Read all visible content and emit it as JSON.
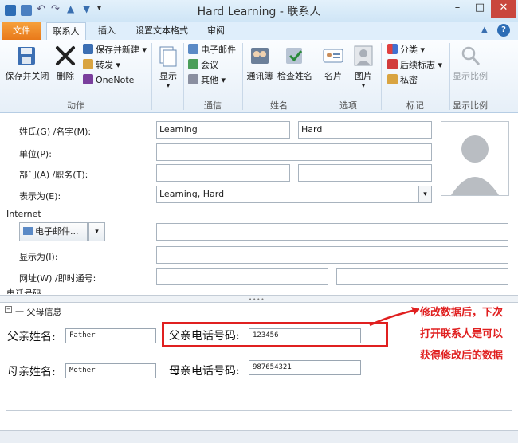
{
  "window": {
    "title": "Hard Learning - 联系人",
    "buttons": {
      "help": "?"
    }
  },
  "tabs": [
    {
      "label": "文件"
    },
    {
      "label": "联系人"
    },
    {
      "label": "插入"
    },
    {
      "label": "设置文本格式"
    },
    {
      "label": "审阅"
    }
  ],
  "ribbon": {
    "actions": {
      "label": "动作",
      "save_close": "保存并关闭",
      "delete": "删除",
      "save_new": "保存并新建",
      "forward": "转发",
      "onenote": "OneNote"
    },
    "show": {
      "label": "显示"
    },
    "communicate": {
      "label": "通信",
      "email": "电子邮件",
      "meeting": "会议",
      "other": "其他"
    },
    "names": {
      "label": "姓名",
      "address_book": "通讯簿",
      "check_names": "检查姓名"
    },
    "options": {
      "label": "选项",
      "card": "名片",
      "picture": "图片"
    },
    "tags": {
      "label": "标记",
      "categorize": "分类",
      "followup": "后续标志",
      "private": "私密"
    },
    "zoom": {
      "label": "显示比例",
      "button": "显示比例"
    }
  },
  "form": {
    "name_label": "姓氏(G)  /名字(M):",
    "last_name": "Learning",
    "first_name": "Hard",
    "company_label": "单位(P):",
    "company": "",
    "dept_label": "部门(A)  /职务(T):",
    "department": "",
    "job_title": "",
    "display_as_label": "表示为(E):",
    "display_as": "Learning, Hard",
    "internet_header": "Internet",
    "email_button": "电子邮件...",
    "email": "",
    "email_display_label": "显示为(I):",
    "email_display": "",
    "web_label": "网址(W)  /即时通号:",
    "web": "",
    "im": "",
    "phone_header": "电话号码"
  },
  "parents": {
    "header": "父母信息",
    "father_name_label": "父亲姓名:",
    "father_name": "Father",
    "father_phone_label": "父亲电话号码:",
    "father_phone": "123456",
    "mother_name_label": "母亲姓名:",
    "mother_name": "Mother",
    "mother_phone_label": "母亲电话号码:",
    "mother_phone": "987654321"
  },
  "annotation": {
    "line1": "修改数据后，下次",
    "line2": "打开联系人是可以",
    "line3": "获得修改后的数据"
  },
  "colors": {
    "file_tab": "#e8791a",
    "highlight": "#e02020",
    "ribbon_bg": "#e6eff8"
  }
}
